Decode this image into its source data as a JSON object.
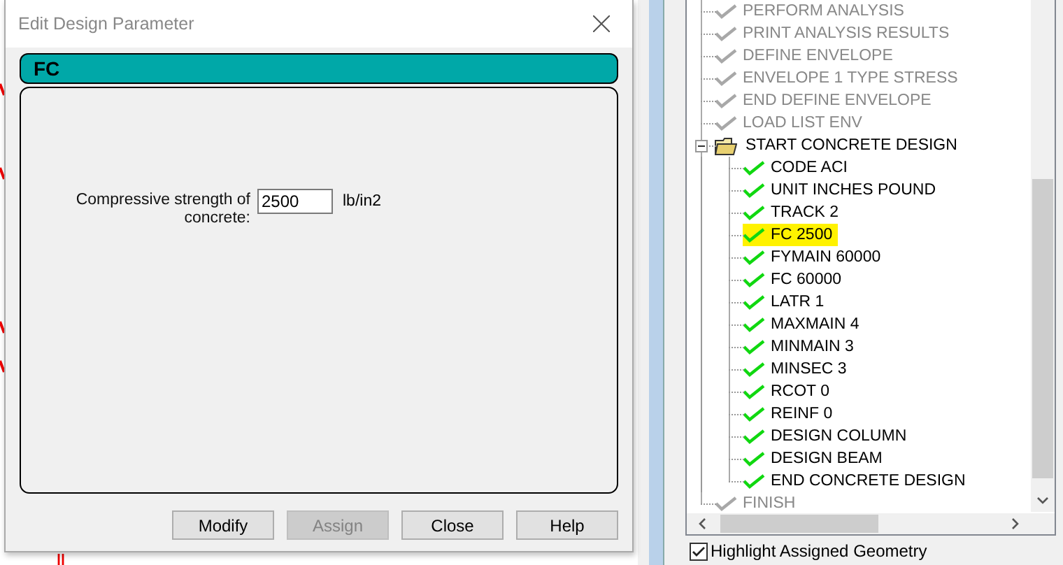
{
  "dialog": {
    "title": "Edit Design Parameter",
    "header": "FC",
    "field": {
      "label": "Compressive strength of concrete:",
      "value": "2500",
      "unit": "lb/in2"
    },
    "buttons": [
      {
        "label": "Modify",
        "disabled": false
      },
      {
        "label": "Assign",
        "disabled": true
      },
      {
        "label": "Close",
        "disabled": false
      },
      {
        "label": "Help",
        "disabled": false
      }
    ]
  },
  "tree": {
    "items": [
      {
        "kind": "command",
        "label": "PERFORM ANALYSIS",
        "greyed": true,
        "selected": false
      },
      {
        "kind": "command",
        "label": "PRINT ANALYSIS RESULTS",
        "greyed": true,
        "selected": false
      },
      {
        "kind": "command",
        "label": "DEFINE ENVELOPE",
        "greyed": true,
        "selected": false
      },
      {
        "kind": "command",
        "label": "ENVELOPE 1 TYPE STRESS",
        "greyed": true,
        "selected": false
      },
      {
        "kind": "command",
        "label": "END DEFINE ENVELOPE",
        "greyed": true,
        "selected": false
      },
      {
        "kind": "command",
        "label": "LOAD LIST ENV",
        "greyed": true,
        "selected": false
      },
      {
        "kind": "folder",
        "label": "START CONCRETE DESIGN",
        "greyed": false,
        "selected": false,
        "expanded": true,
        "children": [
          {
            "kind": "command",
            "label": "CODE ACI",
            "greyed": false,
            "selected": false
          },
          {
            "kind": "command",
            "label": "UNIT INCHES POUND",
            "greyed": false,
            "selected": false
          },
          {
            "kind": "command",
            "label": "TRACK 2",
            "greyed": false,
            "selected": false
          },
          {
            "kind": "command",
            "label": "FC 2500",
            "greyed": false,
            "selected": true
          },
          {
            "kind": "command",
            "label": "FYMAIN 60000",
            "greyed": false,
            "selected": false
          },
          {
            "kind": "command",
            "label": "FC 60000",
            "greyed": false,
            "selected": false
          },
          {
            "kind": "command",
            "label": "LATR 1",
            "greyed": false,
            "selected": false
          },
          {
            "kind": "command",
            "label": "MAXMAIN 4",
            "greyed": false,
            "selected": false
          },
          {
            "kind": "command",
            "label": "MINMAIN 3",
            "greyed": false,
            "selected": false
          },
          {
            "kind": "command",
            "label": "MINSEC 3",
            "greyed": false,
            "selected": false
          },
          {
            "kind": "command",
            "label": "RCOT 0",
            "greyed": false,
            "selected": false
          },
          {
            "kind": "command",
            "label": "REINF 0",
            "greyed": false,
            "selected": false
          },
          {
            "kind": "command",
            "label": "DESIGN COLUMN",
            "greyed": false,
            "selected": false
          },
          {
            "kind": "command",
            "label": "DESIGN BEAM",
            "greyed": false,
            "selected": false
          },
          {
            "kind": "command",
            "label": "END CONCRETE DESIGN",
            "greyed": false,
            "selected": false
          }
        ]
      },
      {
        "kind": "command",
        "label": "FINISH",
        "greyed": true,
        "selected": false
      }
    ]
  },
  "highlight_checkbox": {
    "label": "Highlight Assigned Geometry",
    "checked": true
  }
}
